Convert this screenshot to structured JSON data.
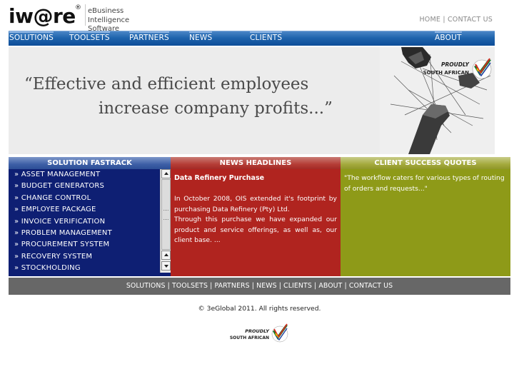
{
  "header": {
    "logo_text": "iw@re",
    "logo_reg": "®",
    "tagline_line1": "eBusiness",
    "tagline_line2": "Intelligence Software",
    "top_links": [
      "HOME",
      "CONTACT US"
    ],
    "top_link_separator": " | "
  },
  "nav": {
    "items": [
      "SOLUTIONS",
      "TOOLSETS",
      "PARTNERS",
      "NEWS",
      "CLIENTS",
      "ABOUT"
    ],
    "bar_color": "#1f64ad"
  },
  "banner": {
    "quote_line1": "“Effective and efficient employees",
    "quote_line2": "increase company profits...”",
    "badge_line1": "PROUDLY",
    "badge_line2": "SOUTH AFRICAN"
  },
  "solution_fastrack": {
    "heading": "SOLUTION FASTRACK",
    "items": [
      "» ASSET MANAGEMENT",
      "» BUDGET GENERATORS",
      "» CHANGE CONTROL",
      "» EMPLOYEE PACKAGE",
      "» INVOICE VERIFICATION",
      "» PROBLEM MANAGEMENT",
      "» PROCUREMENT SYSTEM",
      "» RECOVERY SYSTEM",
      "» STOCKHOLDING"
    ],
    "panel_color": "#0e1f73"
  },
  "news_headlines": {
    "heading": "NEWS HEADLINES",
    "title": "Data Refinery Purchase",
    "body_line1": "In October 2008, OIS extended it's footprint by purchasing Data Refinery (Pty) Ltd.",
    "body_line2": "Through this purchase we have expanded our product and service offerings, as well as, our client base. ...",
    "panel_color": "#b0241f"
  },
  "client_quotes": {
    "heading": "CLIENT SUCCESS QUOTES",
    "body": "\"The workflow caters for various types of routing of orders and requests...\"",
    "panel_color": "#8e9a18"
  },
  "footer": {
    "links_text": "SOLUTIONS | TOOLSETS | PARTNERS | NEWS | CLIENTS | ABOUT | CONTACT US",
    "copyright": "© 3eGlobal 2011. All rights reserved.",
    "badge_line1": "PROUDLY",
    "badge_line2": "SOUTH AFRICAN"
  }
}
